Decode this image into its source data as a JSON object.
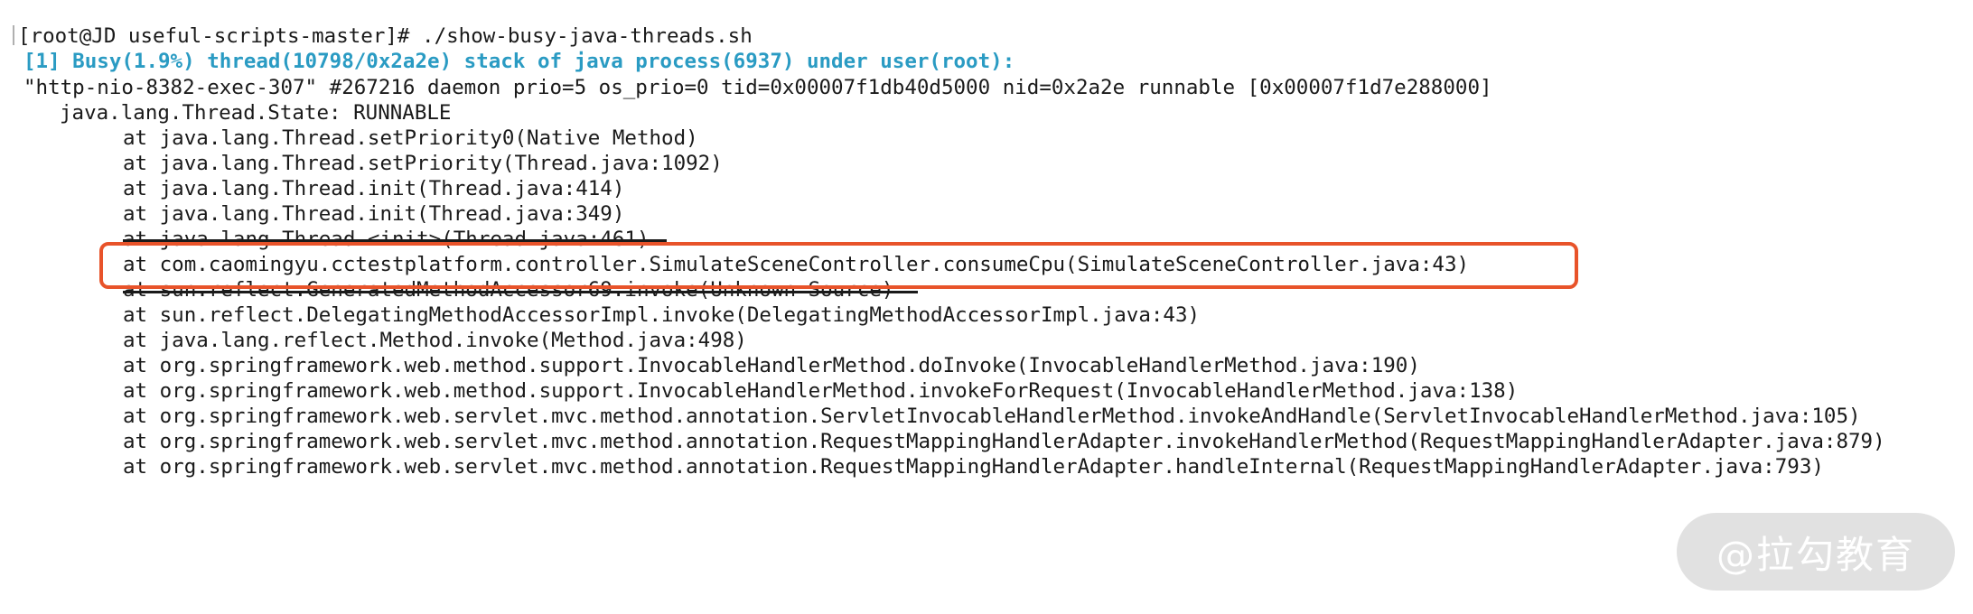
{
  "terminal": {
    "command_line": "[root@JD useful-scripts-master]# ./show-busy-java-threads.sh",
    "header": "[1] Busy(1.9%) thread(10798/0x2a2e) stack of java process(6937) under user(root):",
    "thread_info": "\"http-nio-8382-exec-307\" #267216 daemon prio=5 os_prio=0 tid=0x00007f1db40d5000 nid=0x2a2e runnable [0x00007f1d7e288000]",
    "thread_state": "java.lang.Thread.State: RUNNABLE",
    "stack": [
      "at java.lang.Thread.setPriority0(Native Method)",
      "at java.lang.Thread.setPriority(Thread.java:1092)",
      "at java.lang.Thread.init(Thread.java:414)",
      "at java.lang.Thread.init(Thread.java:349)",
      "at java.lang.Thread.<init>(Thread.java:461)",
      "at com.caomingyu.cctestplatform.controller.SimulateSceneController.consumeCpu(SimulateSceneController.java:43)",
      "at sun.reflect.GeneratedMethodAccessor69.invoke(Unknown Source)",
      "at sun.reflect.DelegatingMethodAccessorImpl.invoke(DelegatingMethodAccessorImpl.java:43)",
      "at java.lang.reflect.Method.invoke(Method.java:498)",
      "at org.springframework.web.method.support.InvocableHandlerMethod.doInvoke(InvocableHandlerMethod.java:190)",
      "at org.springframework.web.method.support.InvocableHandlerMethod.invokeForRequest(InvocableHandlerMethod.java:138)",
      "at org.springframework.web.servlet.mvc.method.annotation.ServletInvocableHandlerMethod.invokeAndHandle(ServletInvocableHandlerMethod.java:105)",
      "at org.springframework.web.servlet.mvc.method.annotation.RequestMappingHandlerAdapter.invokeHandlerMethod(RequestMappingHandlerAdapter.java:879)",
      "at org.springframework.web.servlet.mvc.method.annotation.RequestMappingHandlerAdapter.handleInternal(RequestMappingHandlerAdapter.java:793)"
    ]
  },
  "watermark": "@拉勾教育",
  "colors": {
    "highlight_text": "#2a9bc3",
    "annotation_box": "#e8532a"
  }
}
